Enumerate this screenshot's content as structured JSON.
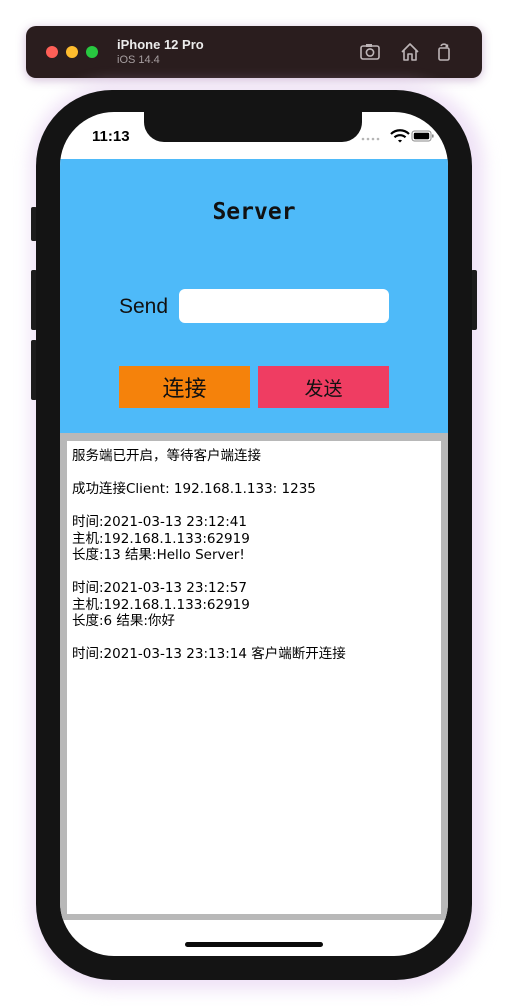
{
  "simulator": {
    "device": "iPhone 12 Pro",
    "os": "iOS 14.4"
  },
  "status_bar": {
    "time": "11:13"
  },
  "app": {
    "title": "Server",
    "send_label": "Send",
    "send_input_value": "",
    "connect_button": "连接",
    "send_button": "发送",
    "colors": {
      "header_bg": "#4ebaf9",
      "connect_bg": "#f5820b",
      "send_bg": "#ef3d62"
    }
  },
  "log": [
    "服务端已开启，等待客户端连接",
    "",
    "成功连接Client: 192.168.1.133: 1235",
    "",
    "时间:2021-03-13 23:12:41",
    "主机:192.168.1.133:62919",
    "长度:13 结果:Hello Server!",
    "",
    "时间:2021-03-13 23:12:57",
    "主机:192.168.1.133:62919",
    "长度:6 结果:你好",
    "",
    "时间:2021-03-13 23:13:14 客户端断开连接"
  ]
}
